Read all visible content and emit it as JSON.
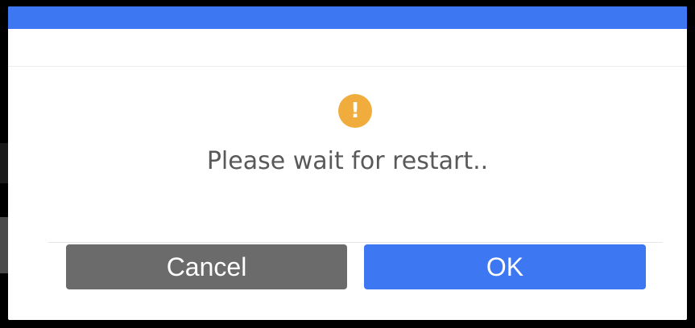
{
  "dialog": {
    "icon": "warning-exclamation-icon",
    "icon_glyph": "!",
    "message": "Please wait for restart..",
    "cancel_label": "Cancel",
    "ok_label": "OK"
  },
  "colors": {
    "accent": "#3d78f2",
    "warning": "#f0ad3e",
    "cancel_button": "#6b6b6b",
    "message_text": "#595959"
  }
}
